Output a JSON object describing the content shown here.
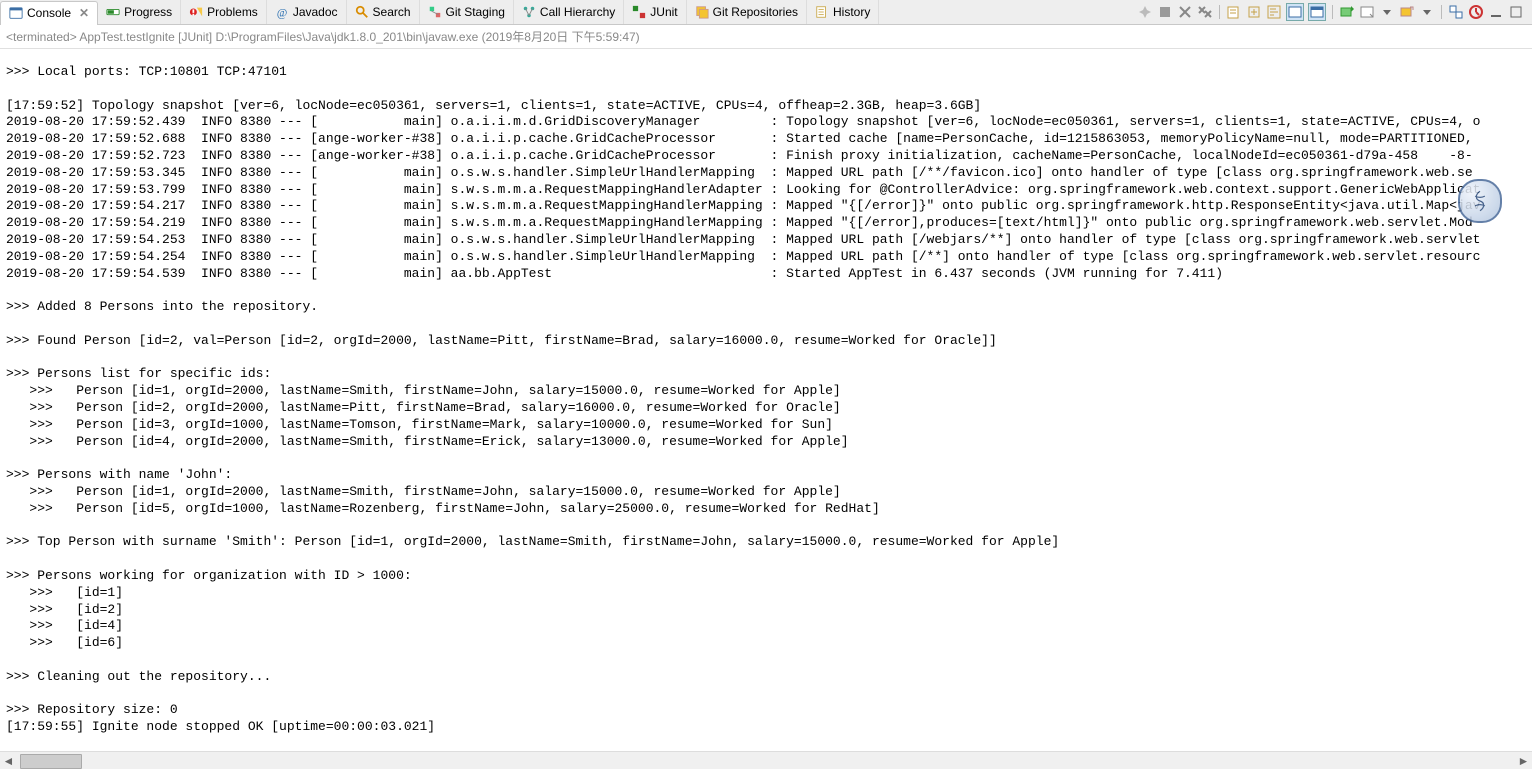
{
  "tabs": [
    {
      "label": "Console",
      "icon": "console-icon",
      "active": true,
      "closeable": true
    },
    {
      "label": "Progress",
      "icon": "progress-icon"
    },
    {
      "label": "Problems",
      "icon": "problems-icon"
    },
    {
      "label": "Javadoc",
      "icon": "javadoc-icon"
    },
    {
      "label": "Search",
      "icon": "search-icon"
    },
    {
      "label": "Git Staging",
      "icon": "git-staging-icon"
    },
    {
      "label": "Call Hierarchy",
      "icon": "call-hierarchy-icon"
    },
    {
      "label": "JUnit",
      "icon": "junit-icon"
    },
    {
      "label": "Git Repositories",
      "icon": "git-repos-icon"
    },
    {
      "label": "History",
      "icon": "history-icon"
    }
  ],
  "status_line": "<terminated> AppTest.testIgnite [JUnit] D:\\ProgramFiles\\Java\\jdk1.8.0_201\\bin\\javaw.exe (2019年8月20日 下午5:59:47)",
  "console_lines": [
    ">>> Local ports: TCP:10801 TCP:47101",
    "",
    "[17:59:52] Topology snapshot [ver=6, locNode=ec050361, servers=1, clients=1, state=ACTIVE, CPUs=4, offheap=2.3GB, heap=3.6GB]",
    "2019-08-20 17:59:52.439  INFO 8380 --- [           main] o.a.i.i.m.d.GridDiscoveryManager         : Topology snapshot [ver=6, locNode=ec050361, servers=1, clients=1, state=ACTIVE, CPUs=4, o",
    "2019-08-20 17:59:52.688  INFO 8380 --- [ange-worker-#38] o.a.i.i.p.cache.GridCacheProcessor       : Started cache [name=PersonCache, id=1215863053, memoryPolicyName=null, mode=PARTITIONED,",
    "2019-08-20 17:59:52.723  INFO 8380 --- [ange-worker-#38] o.a.i.i.p.cache.GridCacheProcessor       : Finish proxy initialization, cacheName=PersonCache, localNodeId=ec050361-d79a-458    -8-",
    "2019-08-20 17:59:53.345  INFO 8380 --- [           main] o.s.w.s.handler.SimpleUrlHandlerMapping  : Mapped URL path [/**/favicon.ico] onto handler of type [class org.springframework.web.se",
    "2019-08-20 17:59:53.799  INFO 8380 --- [           main] s.w.s.m.m.a.RequestMappingHandlerAdapter : Looking for @ControllerAdvice: org.springframework.web.context.support.GenericWebApplicat",
    "2019-08-20 17:59:54.217  INFO 8380 --- [           main] s.w.s.m.m.a.RequestMappingHandlerMapping : Mapped \"{[/error]}\" onto public org.springframework.http.ResponseEntity<java.util.Map<jav",
    "2019-08-20 17:59:54.219  INFO 8380 --- [           main] s.w.s.m.m.a.RequestMappingHandlerMapping : Mapped \"{[/error],produces=[text/html]}\" onto public org.springframework.web.servlet.Mod",
    "2019-08-20 17:59:54.253  INFO 8380 --- [           main] o.s.w.s.handler.SimpleUrlHandlerMapping  : Mapped URL path [/webjars/**] onto handler of type [class org.springframework.web.servlet",
    "2019-08-20 17:59:54.254  INFO 8380 --- [           main] o.s.w.s.handler.SimpleUrlHandlerMapping  : Mapped URL path [/**] onto handler of type [class org.springframework.web.servlet.resourc",
    "2019-08-20 17:59:54.539  INFO 8380 --- [           main] aa.bb.AppTest                            : Started AppTest in 6.437 seconds (JVM running for 7.411)",
    "",
    ">>> Added 8 Persons into the repository.",
    "",
    ">>> Found Person [id=2, val=Person [id=2, orgId=2000, lastName=Pitt, firstName=Brad, salary=16000.0, resume=Worked for Oracle]]",
    "",
    ">>> Persons list for specific ids:",
    "   >>>   Person [id=1, orgId=2000, lastName=Smith, firstName=John, salary=15000.0, resume=Worked for Apple]",
    "   >>>   Person [id=2, orgId=2000, lastName=Pitt, firstName=Brad, salary=16000.0, resume=Worked for Oracle]",
    "   >>>   Person [id=3, orgId=1000, lastName=Tomson, firstName=Mark, salary=10000.0, resume=Worked for Sun]",
    "   >>>   Person [id=4, orgId=2000, lastName=Smith, firstName=Erick, salary=13000.0, resume=Worked for Apple]",
    "",
    ">>> Persons with name 'John':",
    "   >>>   Person [id=1, orgId=2000, lastName=Smith, firstName=John, salary=15000.0, resume=Worked for Apple]",
    "   >>>   Person [id=5, orgId=1000, lastName=Rozenberg, firstName=John, salary=25000.0, resume=Worked for RedHat]",
    "",
    ">>> Top Person with surname 'Smith': Person [id=1, orgId=2000, lastName=Smith, firstName=John, salary=15000.0, resume=Worked for Apple]",
    "",
    ">>> Persons working for organization with ID > 1000:",
    "   >>>   [id=1]",
    "   >>>   [id=2]",
    "   >>>   [id=4]",
    "   >>>   [id=6]",
    "",
    ">>> Cleaning out the repository...",
    "",
    ">>> Repository size: 0",
    "[17:59:55] Ignite node stopped OK [uptime=00:00:03.021]"
  ]
}
